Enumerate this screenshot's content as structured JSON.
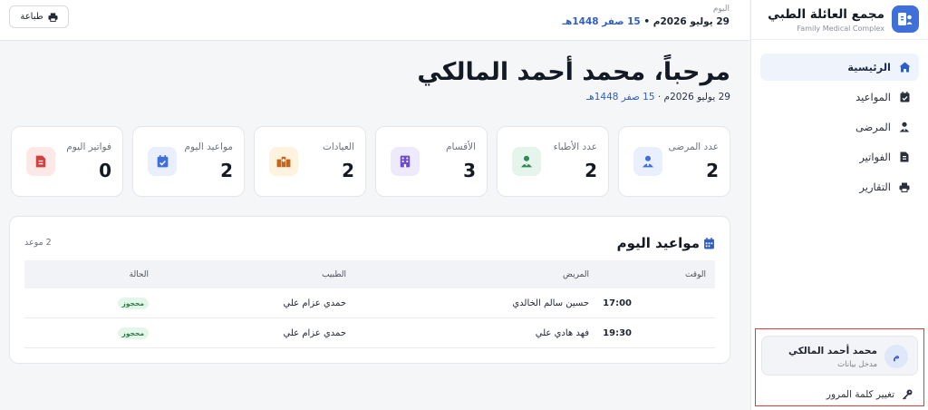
{
  "brand": {
    "title": "مجمع العائلة الطبي",
    "subtitle": "Family Medical Complex"
  },
  "nav": {
    "items": [
      {
        "label": "الرئيسية",
        "icon": "home-icon",
        "active": true
      },
      {
        "label": "المواعيد",
        "icon": "calendar-check-icon",
        "active": false
      },
      {
        "label": "المرضى",
        "icon": "patient-icon",
        "active": false
      },
      {
        "label": "الفواتير",
        "icon": "invoice-icon",
        "active": false
      },
      {
        "label": "التقارير",
        "icon": "printer-icon",
        "active": false
      }
    ]
  },
  "user": {
    "initial": "م",
    "name": "محمد أحمد المالكي",
    "role": "مدخل بيانات",
    "change_password": "تغيير كلمة المرور"
  },
  "topbar": {
    "today_label": "اليوم",
    "date_gregorian": "29 يوليو 2026م",
    "separator": " • ",
    "date_hijri": "15 صفر 1448هـ",
    "print_label": "طباعة"
  },
  "welcome": {
    "greeting": "مرحباً، محمد أحمد المالكي",
    "date_gregorian": "29 يوليو 2026م",
    "separator": " · ",
    "date_hijri": "15 صفر 1448هـ"
  },
  "stats": [
    {
      "label": "عدد المرضى",
      "value": "2",
      "icon": "patient-icon",
      "color": "#3f6fd8",
      "bg": "#e9effc"
    },
    {
      "label": "عدد الأطباء",
      "value": "2",
      "icon": "doctor-icon",
      "color": "#2f8a57",
      "bg": "#e6f5ec"
    },
    {
      "label": "الأقسام",
      "value": "3",
      "icon": "building-icon",
      "color": "#6d4bd1",
      "bg": "#efeafb"
    },
    {
      "label": "العيادات",
      "value": "2",
      "icon": "clinics-icon",
      "color": "#c2671d",
      "bg": "#fdf3de"
    },
    {
      "label": "مواعيد اليوم",
      "value": "2",
      "icon": "calendar-check-icon",
      "color": "#3f6fd8",
      "bg": "#e9effc"
    },
    {
      "label": "فواتير اليوم",
      "value": "0",
      "icon": "invoice-icon",
      "color": "#d23f3f",
      "bg": "#fde8e8"
    }
  ],
  "appointments": {
    "title": "مواعيد اليوم",
    "count": "2 موعد",
    "columns": [
      "الوقت",
      "المريض",
      "الطبيب",
      "الحالة"
    ],
    "rows": [
      {
        "time": "17:00",
        "patient": "حسين سالم الخالدي",
        "doctor": "حمدي عزام علي",
        "status": "محجوز"
      },
      {
        "time": "19:30",
        "patient": "فهد هادي علي",
        "doctor": "حمدي عزام علي",
        "status": "محجوز"
      }
    ]
  },
  "colors": {
    "accent": "#3f6fd8",
    "hijri": "#2f5fc4",
    "highlight_border": "#e23a3a"
  }
}
